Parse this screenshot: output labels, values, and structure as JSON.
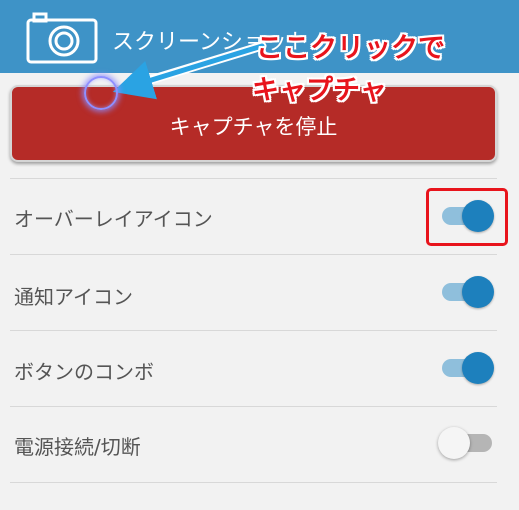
{
  "header": {
    "title": "スクリーンショット",
    "icon": "camera-icon",
    "color": "#3e93c7"
  },
  "stop_button": {
    "label": "キャプチャを停止",
    "color": "#b52b27"
  },
  "annotation": {
    "callout_line1": "ここクリックで",
    "callout_line2": "キャプチャ",
    "color": "#e8141c"
  },
  "settings": [
    {
      "label": "オーバーレイアイコン",
      "enabled": true,
      "highlighted": true
    },
    {
      "label": "通知アイコン",
      "enabled": true
    },
    {
      "label": "ボタンのコンボ",
      "enabled": true
    },
    {
      "label": "電源接続/切断",
      "enabled": false
    }
  ],
  "toggle_on_color": "#1d80bd"
}
